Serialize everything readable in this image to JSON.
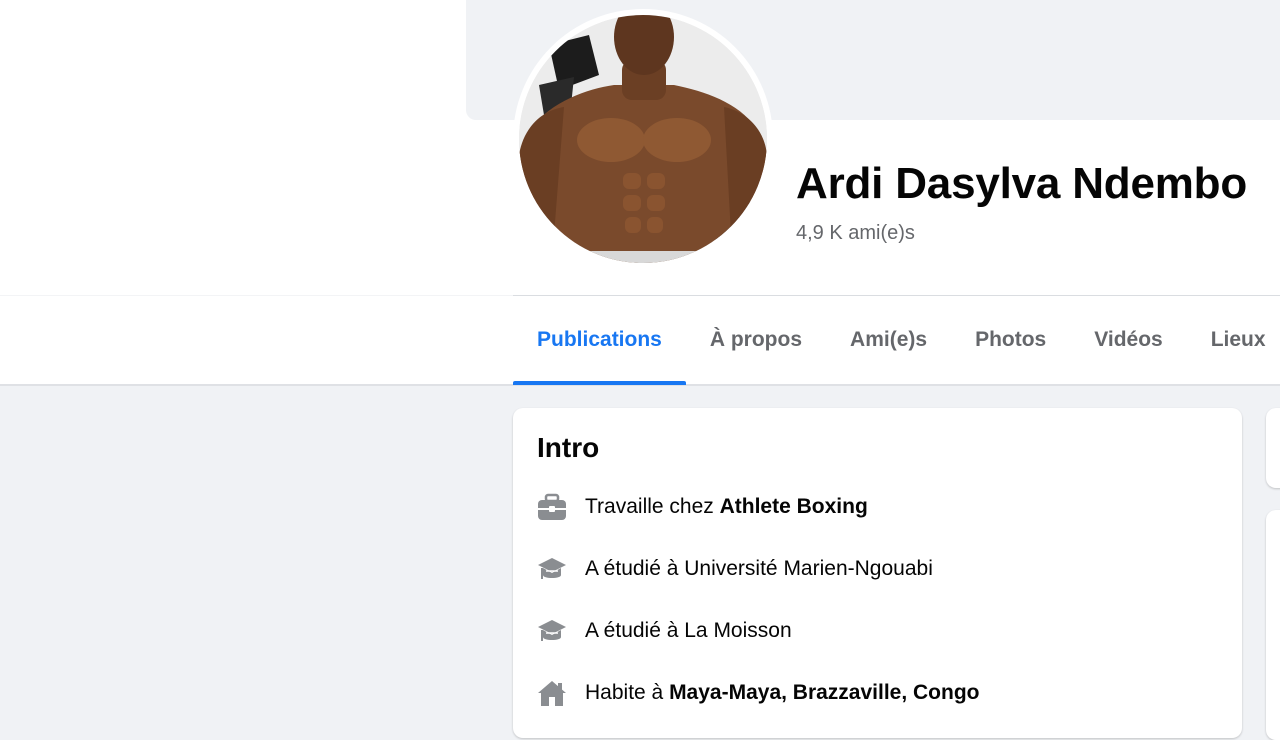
{
  "profile": {
    "name": "Ardi Dasylva Ndembo",
    "friends_count": "4,9 K ami(e)s"
  },
  "tabs": [
    {
      "label": "Publications",
      "active": true
    },
    {
      "label": "À propos",
      "active": false
    },
    {
      "label": "Ami(e)s",
      "active": false
    },
    {
      "label": "Photos",
      "active": false
    },
    {
      "label": "Vidéos",
      "active": false
    },
    {
      "label": "Lieux",
      "active": false
    }
  ],
  "intro": {
    "title": "Intro",
    "items": [
      {
        "icon": "briefcase-icon",
        "prefix": "Travaille chez ",
        "highlight": "Athlete Boxing"
      },
      {
        "icon": "graduation-cap-icon",
        "prefix": "A étudié à Université Marien-Ngouabi",
        "highlight": ""
      },
      {
        "icon": "graduation-cap-icon",
        "prefix": "A étudié à La Moisson",
        "highlight": ""
      },
      {
        "icon": "home-icon",
        "prefix": "Habite à ",
        "highlight": "Maya-Maya, Brazzaville, Congo"
      }
    ]
  },
  "colors": {
    "accent": "#1877f2",
    "secondary_text": "#65676b",
    "page_bg": "#f0f2f5"
  }
}
